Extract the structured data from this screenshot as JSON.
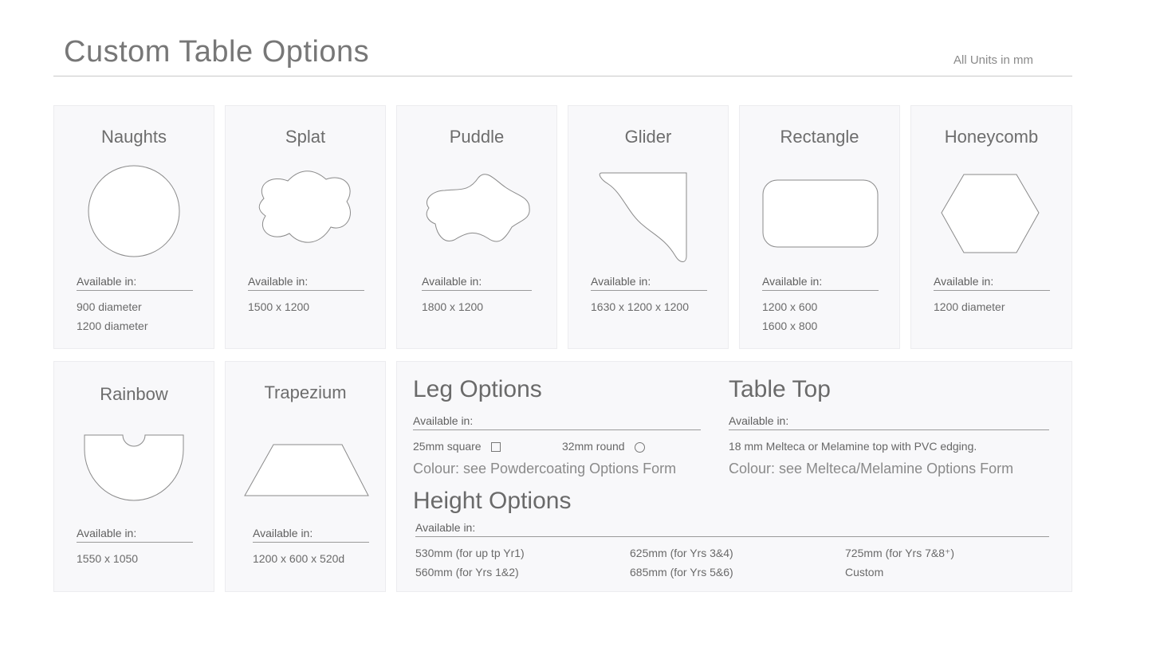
{
  "header": {
    "title": "Custom Table Options",
    "units": "All Units in mm"
  },
  "available_label": "Available in:",
  "tables": [
    {
      "name": "Naughts",
      "sizes": [
        "900 diameter",
        "1200 diameter"
      ]
    },
    {
      "name": "Splat",
      "sizes": [
        "1500 x 1200"
      ]
    },
    {
      "name": "Puddle",
      "sizes": [
        "1800 x 1200"
      ]
    },
    {
      "name": "Glider",
      "sizes": [
        "1630 x 1200 x 1200"
      ]
    },
    {
      "name": "Rectangle",
      "sizes": [
        "1200 x 600",
        "1600 x 800"
      ]
    },
    {
      "name": "Honeycomb",
      "sizes": [
        "1200 diameter"
      ]
    },
    {
      "name": "Rainbow",
      "sizes": [
        "1550 x 1050"
      ]
    },
    {
      "name": "Trapezium",
      "sizes": [
        "1200 x 600 x 520d"
      ]
    }
  ],
  "leg_options": {
    "title": "Leg Options",
    "square": "25mm square",
    "round": "32mm round",
    "colour": "Colour: see Powdercoating Options Form"
  },
  "table_top": {
    "title": "Table Top",
    "description": "18 mm Melteca or Melamine top with PVC edging.",
    "colour": "Colour: see Melteca/Melamine Options Form"
  },
  "height_options": {
    "title": "Height Options",
    "heights": [
      [
        "530mm  (for up tp Yr1)",
        "560mm  (for Yrs 1&2)"
      ],
      [
        "625mm  (for Yrs 3&4)",
        "685mm (for Yrs 5&6)"
      ],
      [
        "725mm  (for Yrs 7&8⁺)",
        "Custom"
      ]
    ]
  }
}
